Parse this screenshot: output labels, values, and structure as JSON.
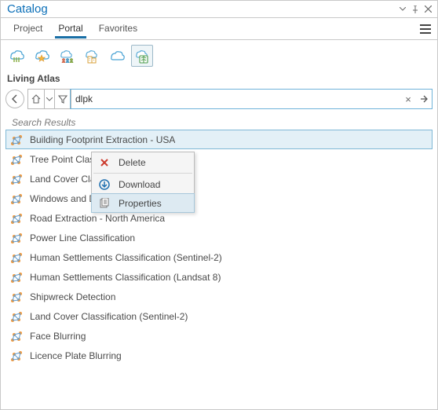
{
  "window": {
    "title": "Catalog"
  },
  "tabs": {
    "project": "Project",
    "portal": "Portal",
    "favorites": "Favorites"
  },
  "breadcrumb": "Living Atlas",
  "search": {
    "value": "dlpk"
  },
  "results_header": "Search Results",
  "results": [
    "Building Footprint Extraction - USA",
    "Tree Point Classification",
    "Land Cover Classification (Landsat 8)",
    "Windows and Doors Extraction",
    "Road Extraction - North America",
    "Power Line Classification",
    "Human Settlements Classification (Sentinel-2)",
    "Human Settlements Classification (Landsat 8)",
    "Shipwreck Detection",
    "Land Cover Classification (Sentinel-2)",
    "Face Blurring",
    "Licence Plate Blurring"
  ],
  "context_menu": {
    "delete": "Delete",
    "download": "Download",
    "properties": "Properties"
  }
}
